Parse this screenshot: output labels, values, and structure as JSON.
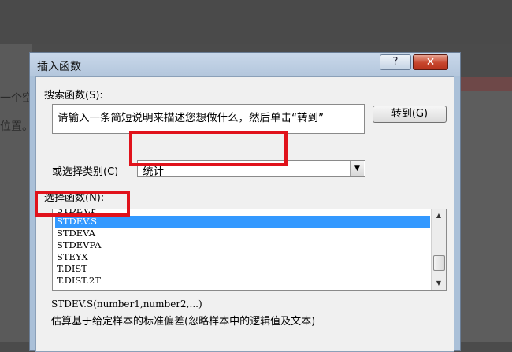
{
  "background": {
    "text_line_1": "一个空",
    "text_line_2": "位置。"
  },
  "dialog": {
    "title": "插入函数",
    "help_button": "?",
    "close_button": "✕",
    "search_label": "搜索函数(S):",
    "search_text": "请输入一条简短说明来描述您想做什么，然后单击“转到”",
    "go_button": "转到(G)",
    "category_label": "或选择类别(C)",
    "category_value": "统计",
    "function_label": "选择函数(N):",
    "functions": [
      "STDEV.P",
      "STDEV.S",
      "STDEVA",
      "STDEVPA",
      "STEYX",
      "T.DIST",
      "T.DIST.2T"
    ],
    "selected_function": "STDEV.S",
    "syntax": "STDEV.S(number1,number2,...)",
    "description": "估算基于给定样本的标准偏差(忽略样本中的逻辑值及文本)"
  },
  "annotations": {
    "highlight_color": "#e0121b"
  }
}
